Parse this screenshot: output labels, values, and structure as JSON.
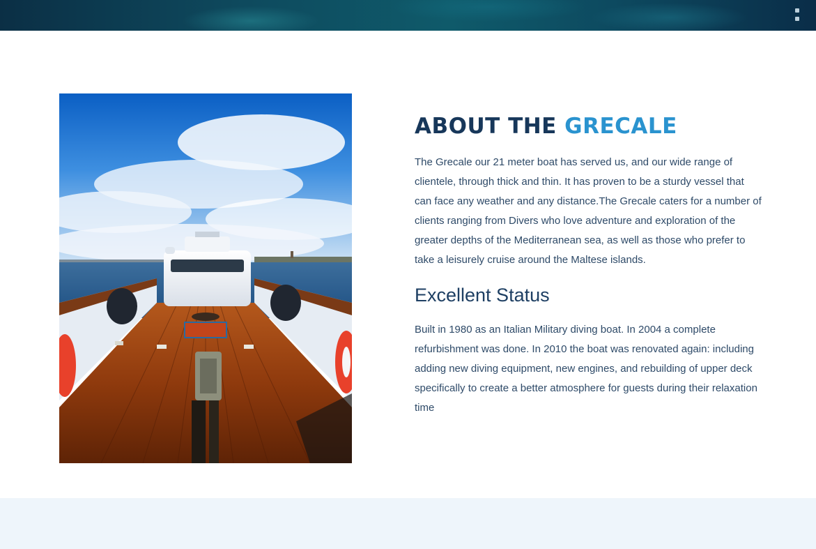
{
  "hero": {
    "background_color": "#0e4a5e"
  },
  "about": {
    "title_prefix": "ABOUT THE ",
    "title_accent": "GRECALE",
    "title_color": "#17375a",
    "accent_color": "#2a93cf",
    "paragraph": "The Grecale our 21 meter boat has served us, and our wide range of clientele, through thick and thin. It has proven to be a sturdy vessel that can face any weather and any distance.The Grecale caters for a number of clients ranging from Divers who love adventure and exploration of the greater depths of the Mediterranean sea, as well as those who prefer to take a leisurely cruise around the Maltese islands.",
    "status_heading": "Excellent Status",
    "status_paragraph": "Built in 1980 as an Italian Military diving boat. In 2004 a complete refurbishment was done. In 2010 the boat was renovated again: including adding new diving equipment, new engines, and rebuilding of upper deck specifically to create a better atmosphere for guests during their relaxation time",
    "photo_icon": "boat-deck-photo"
  },
  "footer_band": {
    "background_color": "#eef5fb"
  }
}
